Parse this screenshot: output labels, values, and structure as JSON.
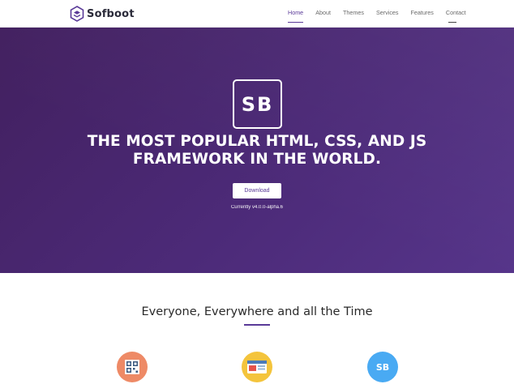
{
  "brand": {
    "name": "Sofboot",
    "logo_icon": "cube-logo-icon"
  },
  "nav": {
    "items": [
      {
        "label": "Home",
        "active": true
      },
      {
        "label": "About",
        "active": false
      },
      {
        "label": "Themes",
        "active": false
      },
      {
        "label": "Services",
        "active": false
      },
      {
        "label": "Features",
        "active": false
      },
      {
        "label": "Contact",
        "active": false
      }
    ]
  },
  "hero": {
    "logo_text": "SB",
    "title_line1": "THE MOST POPULAR HTML, CSS, AND JS",
    "title_line2": "FRAMEWORK IN THE WORLD.",
    "download_label": "Download",
    "version_text": "Currently v4.0.0-alpha.6"
  },
  "section": {
    "title": "Everyone, Everywhere and all the Time",
    "features": [
      {
        "icon": "qr-grid-icon",
        "color": "#ee8a66"
      },
      {
        "icon": "browser-window-icon",
        "color": "#f4c43c"
      },
      {
        "icon": "sb-logo-icon",
        "text": "SB",
        "color": "#49aaf3"
      }
    ]
  },
  "colors": {
    "accent": "#5a3a98",
    "hero_bg": "#4c2a78"
  }
}
